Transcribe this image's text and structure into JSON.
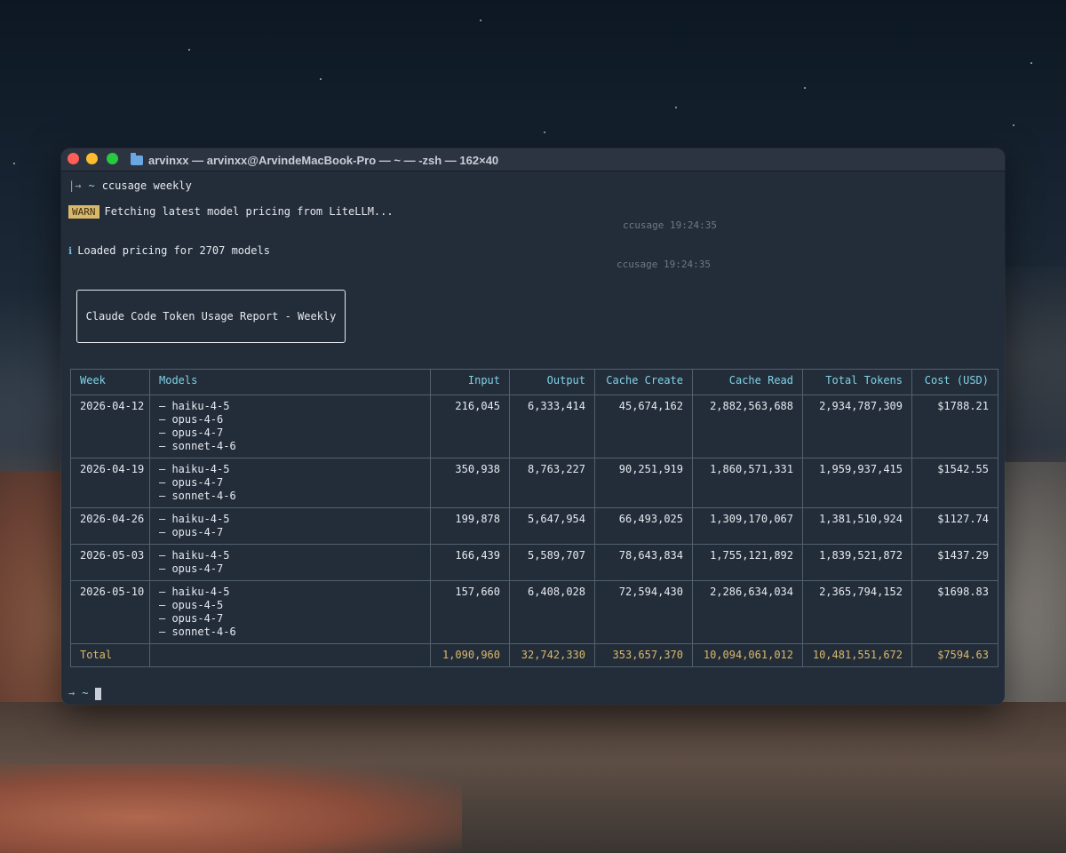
{
  "window": {
    "title": "arvinxx — arvinxx@ArvindeMacBook-Pro — ~ — -zsh — 162×40"
  },
  "terminal": {
    "prompt_arrow": "|→",
    "prompt_tilde": "~",
    "command": "ccusage weekly",
    "warn_label": "WARN",
    "warn_message": "Fetching latest model pricing from LiteLLM...",
    "warn_timestamp": "ccusage 19:24:35",
    "info_icon": "ℹ",
    "info_message": "Loaded pricing for 2707 models",
    "info_timestamp": "ccusage 19:24:35",
    "report_title": "Claude Code Token Usage Report - Weekly",
    "final_prompt_arrow": "→",
    "final_prompt_tilde": "~"
  },
  "table": {
    "headers": [
      "Week",
      "Models",
      "Input",
      "Output",
      "Cache Create",
      "Cache Read",
      "Total Tokens",
      "Cost (USD)"
    ],
    "rows": [
      {
        "week": "2026-04-12",
        "models": [
          "haiku-4-5",
          "opus-4-6",
          "opus-4-7",
          "sonnet-4-6"
        ],
        "input": "216,045",
        "output": "6,333,414",
        "cache_create": "45,674,162",
        "cache_read": "2,882,563,688",
        "total_tokens": "2,934,787,309",
        "cost": "$1788.21"
      },
      {
        "week": "2026-04-19",
        "models": [
          "haiku-4-5",
          "opus-4-7",
          "sonnet-4-6"
        ],
        "input": "350,938",
        "output": "8,763,227",
        "cache_create": "90,251,919",
        "cache_read": "1,860,571,331",
        "total_tokens": "1,959,937,415",
        "cost": "$1542.55"
      },
      {
        "week": "2026-04-26",
        "models": [
          "haiku-4-5",
          "opus-4-7"
        ],
        "input": "199,878",
        "output": "5,647,954",
        "cache_create": "66,493,025",
        "cache_read": "1,309,170,067",
        "total_tokens": "1,381,510,924",
        "cost": "$1127.74"
      },
      {
        "week": "2026-05-03",
        "models": [
          "haiku-4-5",
          "opus-4-7"
        ],
        "input": "166,439",
        "output": "5,589,707",
        "cache_create": "78,643,834",
        "cache_read": "1,755,121,892",
        "total_tokens": "1,839,521,872",
        "cost": "$1437.29"
      },
      {
        "week": "2026-05-10",
        "models": [
          "haiku-4-5",
          "opus-4-5",
          "opus-4-7",
          "sonnet-4-6"
        ],
        "input": "157,660",
        "output": "6,408,028",
        "cache_create": "72,594,430",
        "cache_read": "2,286,634,034",
        "total_tokens": "2,365,794,152",
        "cost": "$1698.83"
      }
    ],
    "total": {
      "label": "Total",
      "input": "1,090,960",
      "output": "32,742,330",
      "cache_create": "353,657,370",
      "cache_read": "10,094,061,012",
      "total_tokens": "10,481,551,672",
      "cost": "$7594.63"
    }
  },
  "colors": {
    "terminal_bg": "#232d3a",
    "header_cyan": "#7fd3e6",
    "total_yellow": "#d9b86a",
    "warn_badge": "#d9b86a",
    "close": "#ff5f57",
    "minimize": "#febc2e",
    "zoom": "#28c840"
  },
  "icons": [
    "close-button",
    "minimize-button",
    "zoom-button",
    "folder-icon",
    "info-icon",
    "cursor"
  ]
}
